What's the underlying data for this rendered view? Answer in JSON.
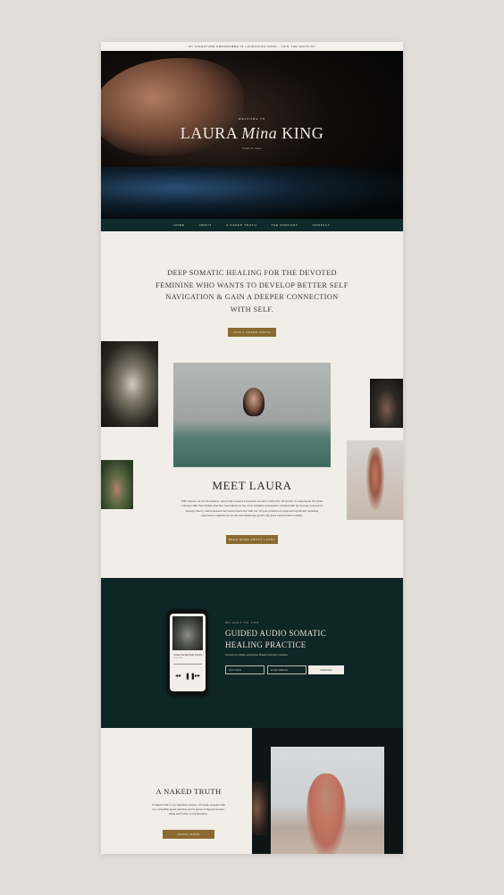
{
  "announcement": "MY SIGNATURE PROGRAMME IS LAUNCHING SOON - JOIN THE WAITLIST",
  "hero": {
    "welcome": "WELCOME TO",
    "name_first": "LAURA",
    "name_middle": "Mina",
    "name_last": "KING",
    "subtitle": "craft & care"
  },
  "nav": [
    "HOME",
    "ABOUT",
    "A NAKED TRUTH",
    "THE PODCAST",
    "CONTACT"
  ],
  "intro": {
    "tagline": "DEEP SOMATIC HEALING FOR THE DEVOTED FEMININE WHO WANTS TO DEVELOP BETTER SELF NAVIGATION & GAIN A DEEPER CONNECTION WITH SELF.",
    "button": "JOIN A NAKED TRUTH"
  },
  "meet": {
    "title": "MEET LAURA",
    "text": "With science as her foundation, Laura has created a powerful somatic method for all women to experience the deep intimacy with their bodies that she now claims as her most valuable possession. Infused with pioneering movement therapy theory, Laura weaves her lived experience with her 10 year practice of yoga and significant travelling experience together for an all encompassing psycho-physical experiential modality.",
    "button": "READ MORE ABOUT LAURA"
  },
  "gift": {
    "kicker": "MY GIFT TO YOU",
    "title": "GUIDED AUDIO SOMATIC HEALING PRACTICE",
    "description": "Access my wildly expansive Breath intimacy practice",
    "first_name_placeholder": "First name",
    "email_placeholder": "Email address",
    "subscribe": "Subscribe",
    "track_title": "A Deep Somatic Body Practice",
    "track_artist": "Laura King"
  },
  "naked_truth": {
    "title": "A NAKED TRUTH",
    "text": "A Naked Truth is my signature service. A 6 week program with me, incredible guest teachers and a group of aligned women, lifting each other to full liberation.",
    "button": "LEARN MORE"
  }
}
